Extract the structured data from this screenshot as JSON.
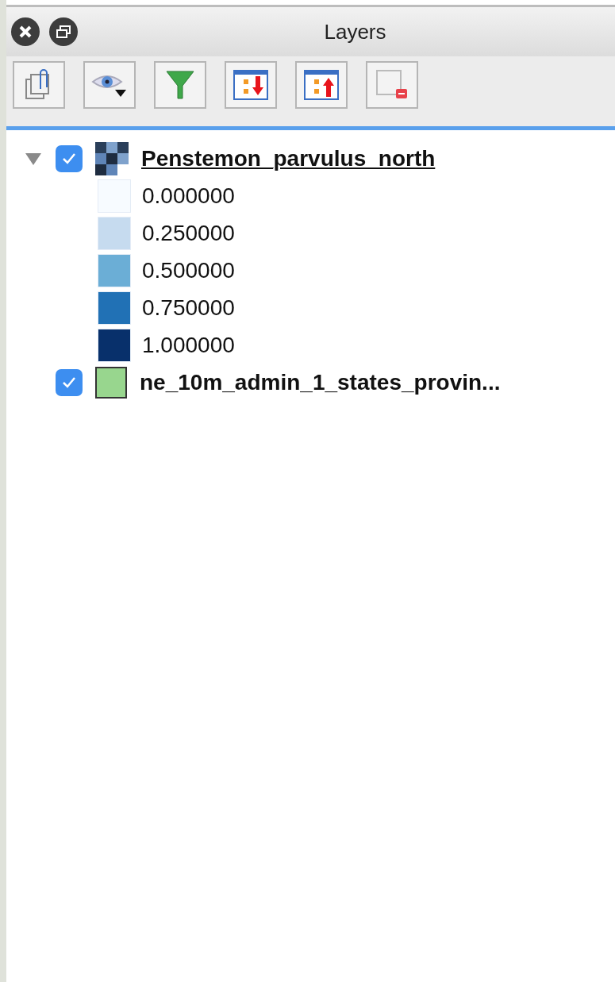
{
  "window": {
    "title": "Layers"
  },
  "toolbar": [
    {
      "kind": "clip"
    },
    {
      "kind": "eye"
    },
    {
      "kind": "filter"
    },
    {
      "kind": "expand"
    },
    {
      "kind": "collapse"
    },
    {
      "kind": "remove"
    }
  ],
  "layers": [
    {
      "name": "Penstemon_parvulus_north",
      "checked": true,
      "current": true,
      "expanded": true,
      "kind": "raster",
      "legend": [
        {
          "label": "0.000000",
          "color": "#f7fbff"
        },
        {
          "label": "0.250000",
          "color": "#c6dbef"
        },
        {
          "label": "0.500000",
          "color": "#6baed6"
        },
        {
          "label": "0.750000",
          "color": "#2171b5"
        },
        {
          "label": "1.000000",
          "color": "#08306b"
        }
      ]
    },
    {
      "name": "ne_10m_admin_1_states_provin...",
      "checked": true,
      "current": false,
      "kind": "fill",
      "color": "#98d68e"
    }
  ]
}
